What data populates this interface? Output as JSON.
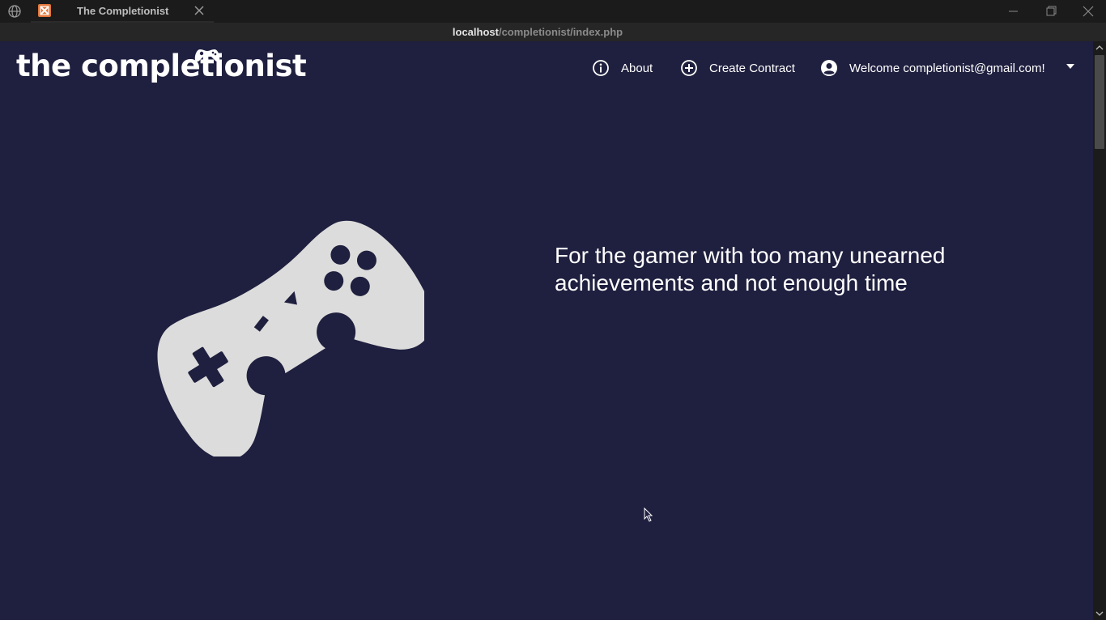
{
  "browser": {
    "tab_title": "The Completionist",
    "url_host": "localhost",
    "url_path": "/completionist/index.php"
  },
  "header": {
    "logo_text": "the completionist",
    "nav": {
      "about": "About",
      "create_contract": "Create Contract",
      "welcome": "Welcome completionist@gmail.com!"
    }
  },
  "hero": {
    "tagline_line1": "For the gamer with too many unearned",
    "tagline_line2": "achievements and not enough time"
  },
  "colors": {
    "page_bg": "#1f1f3f",
    "controller": "#dcdcdc",
    "text": "#ffffff"
  },
  "icons": [
    "globe-icon",
    "site-favicon",
    "close-icon",
    "minimize-icon",
    "restore-icon",
    "info-icon",
    "plus-circle-icon",
    "user-circle-icon",
    "caret-down-icon",
    "gamepad-icon"
  ]
}
